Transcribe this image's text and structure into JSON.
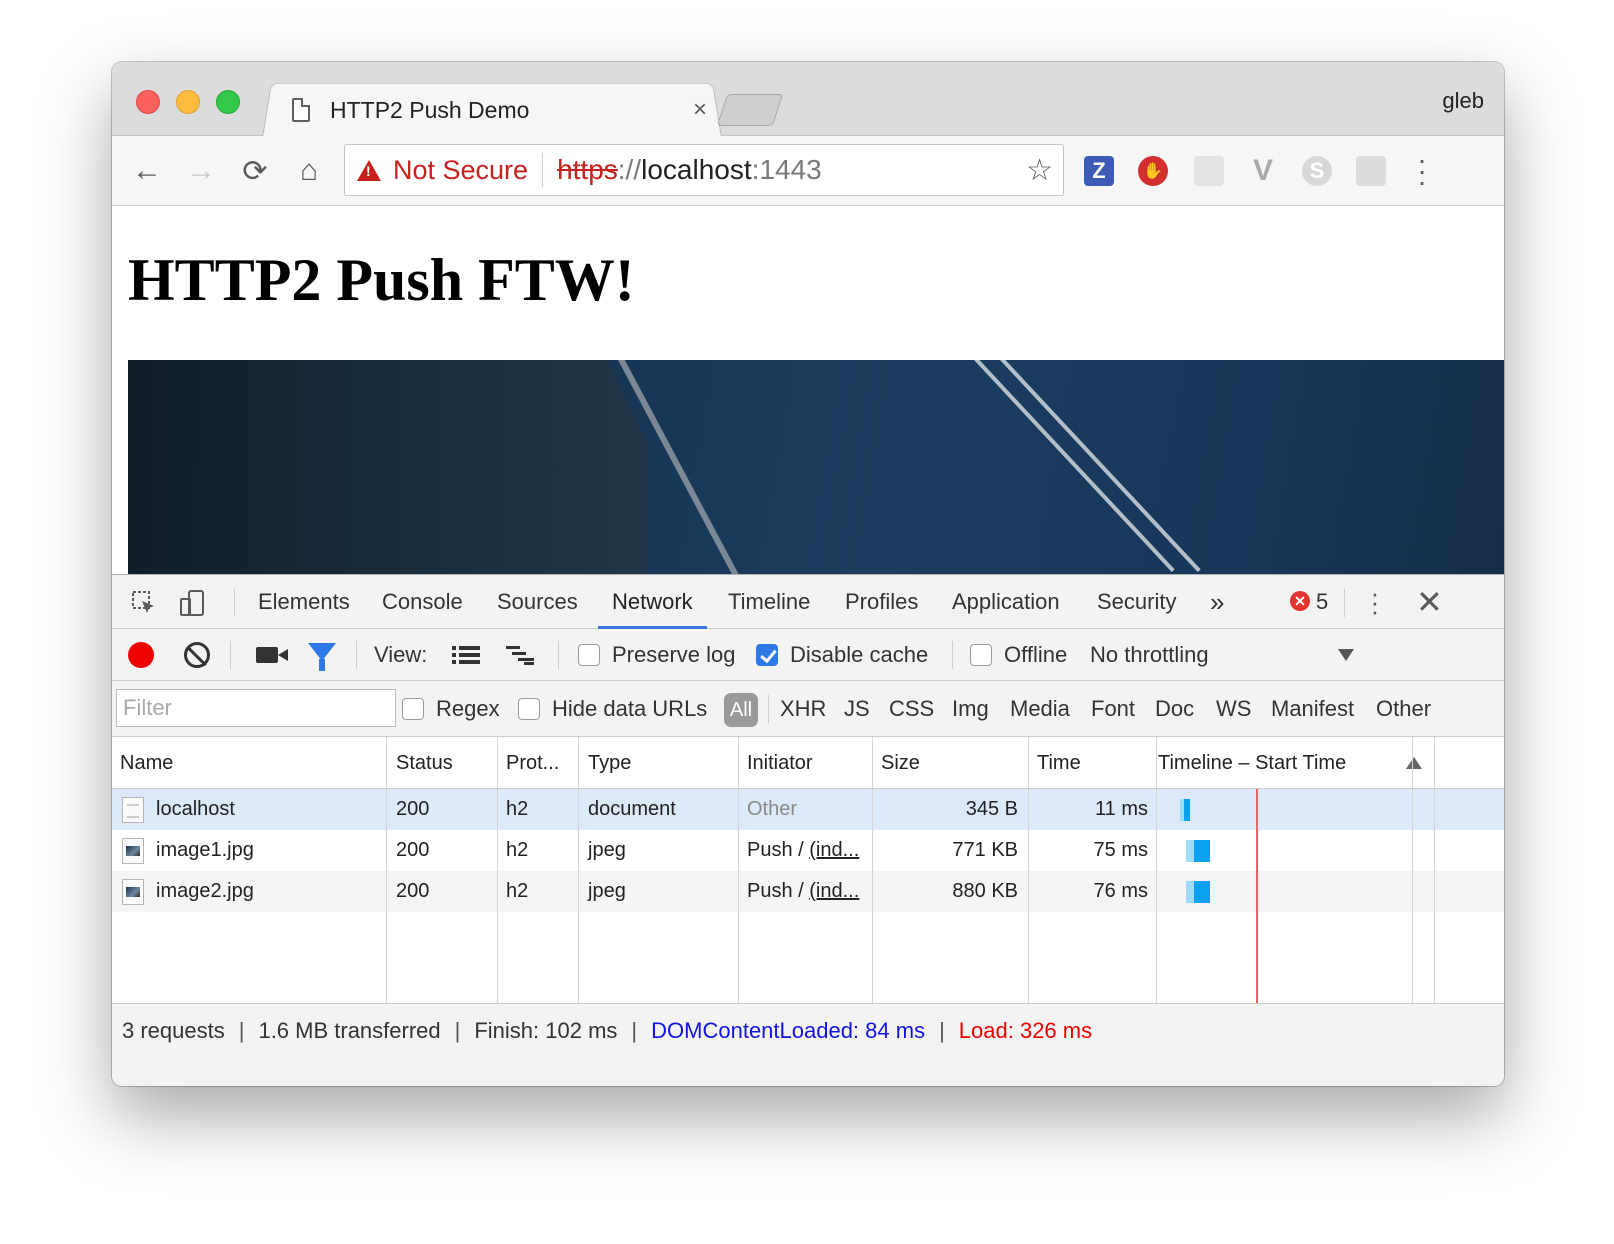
{
  "window": {
    "tab_title": "HTTP2 Push Demo",
    "tab_close": "×",
    "profile_name": "gleb"
  },
  "toolbar": {
    "back": "←",
    "forward": "→",
    "reload": "⟳",
    "home": "⌂",
    "security_label": "Not Secure",
    "url_scheme": "https",
    "url_sep": "://",
    "url_host": "localhost",
    "url_port": ":1443",
    "star": "☆",
    "extensions": [
      "Z",
      "✋",
      "",
      "V",
      "S",
      ""
    ],
    "menu": "⋮"
  },
  "page": {
    "heading": "HTTP2 Push FTW!"
  },
  "devtools": {
    "tabs": [
      "Elements",
      "Console",
      "Sources",
      "Network",
      "Timeline",
      "Profiles",
      "Application",
      "Security"
    ],
    "active_tab": "Network",
    "more_tabs": "»",
    "error_badge": "✕",
    "error_count": "5",
    "menu": "⋮",
    "close": "✕",
    "toolbar": {
      "view_label": "View:",
      "preserve_log": "Preserve log",
      "preserve_log_checked": false,
      "disable_cache": "Disable cache",
      "disable_cache_checked": true,
      "offline": "Offline",
      "offline_checked": false,
      "throttling": "No throttling"
    },
    "filterbar": {
      "filter_placeholder": "Filter",
      "regex": "Regex",
      "hide_data_urls": "Hide data URLs",
      "types": [
        "All",
        "XHR",
        "JS",
        "CSS",
        "Img",
        "Media",
        "Font",
        "Doc",
        "WS",
        "Manifest",
        "Other"
      ],
      "active_type": "All"
    },
    "grid": {
      "headers": [
        "Name",
        "Status",
        "Prot...",
        "Type",
        "Initiator",
        "Size",
        "Time",
        "Timeline – Start Time"
      ],
      "rows": [
        {
          "name": "localhost",
          "status": "200",
          "protocol": "h2",
          "type": "document",
          "initiator": "Other",
          "initiator_link": "",
          "size": "345 B",
          "time": "11 ms",
          "icon": "doc-icon"
        },
        {
          "name": "image1.jpg",
          "status": "200",
          "protocol": "h2",
          "type": "jpeg",
          "initiator": "Push / ",
          "initiator_link": "(ind...",
          "size": "771 KB",
          "time": "75 ms",
          "icon": "image-icon"
        },
        {
          "name": "image2.jpg",
          "status": "200",
          "protocol": "h2",
          "type": "jpeg",
          "initiator": "Push / ",
          "initiator_link": "(ind...",
          "size": "880 KB",
          "time": "76 ms",
          "icon": "image-icon"
        }
      ]
    },
    "status": {
      "requests": "3 requests",
      "transferred": "1.6 MB transferred",
      "finish": "Finish: 102 ms",
      "dom_content_loaded": "DOMContentLoaded: 84 ms",
      "load": "Load: 326 ms",
      "separator": "|"
    }
  },
  "colors": {
    "accent_blue": "#3879d9",
    "record_red": "#ee0000",
    "dcl_blue": "#1414e0",
    "load_red": "#ee0000",
    "selected_row": "#dce9f9",
    "waterfall_blue": "#0aa1ee",
    "insecure_red": "#c5221f"
  }
}
